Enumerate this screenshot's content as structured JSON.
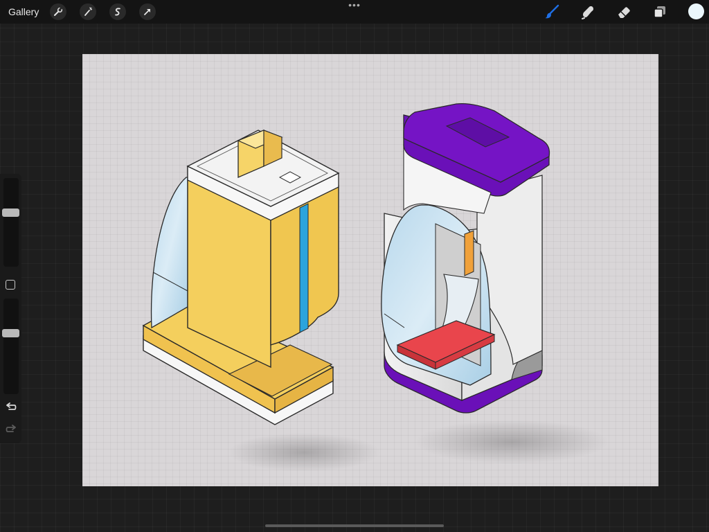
{
  "toolbar": {
    "gallery_label": "Gallery",
    "left_tools": [
      {
        "name": "actions",
        "icon": "wrench-icon"
      },
      {
        "name": "adjustments",
        "icon": "magic-wand-icon"
      },
      {
        "name": "selection",
        "icon": "selection-s-icon"
      },
      {
        "name": "transform",
        "icon": "arrow-cursor-icon"
      }
    ],
    "more_icon": "more-dots-icon",
    "more_glyph": "•••",
    "right_tools": [
      {
        "name": "brush",
        "icon": "brush-icon",
        "active": true
      },
      {
        "name": "smudge",
        "icon": "smudge-icon",
        "active": false
      },
      {
        "name": "eraser",
        "icon": "eraser-icon",
        "active": false
      },
      {
        "name": "layers",
        "icon": "layers-icon",
        "active": false
      }
    ],
    "current_color": "#eaf6fb",
    "active_tool_color": "#1f6fe5"
  },
  "sidebar": {
    "brush_size_level": 0.38,
    "opacity_level": 0.35,
    "modify_icon": "square-modify-icon",
    "undo_icon": "undo-icon",
    "redo_icon": "redo-icon"
  },
  "canvas": {
    "background_color": "#d9d6d8",
    "objects": [
      {
        "name": "yellow-machine-sketch",
        "primary_color": "#f4cf5d",
        "accent_color": "#2ba4dd"
      },
      {
        "name": "purple-machine-sketch",
        "primary_color": "#6a10b8",
        "accent_color": "#e9454c"
      }
    ]
  }
}
